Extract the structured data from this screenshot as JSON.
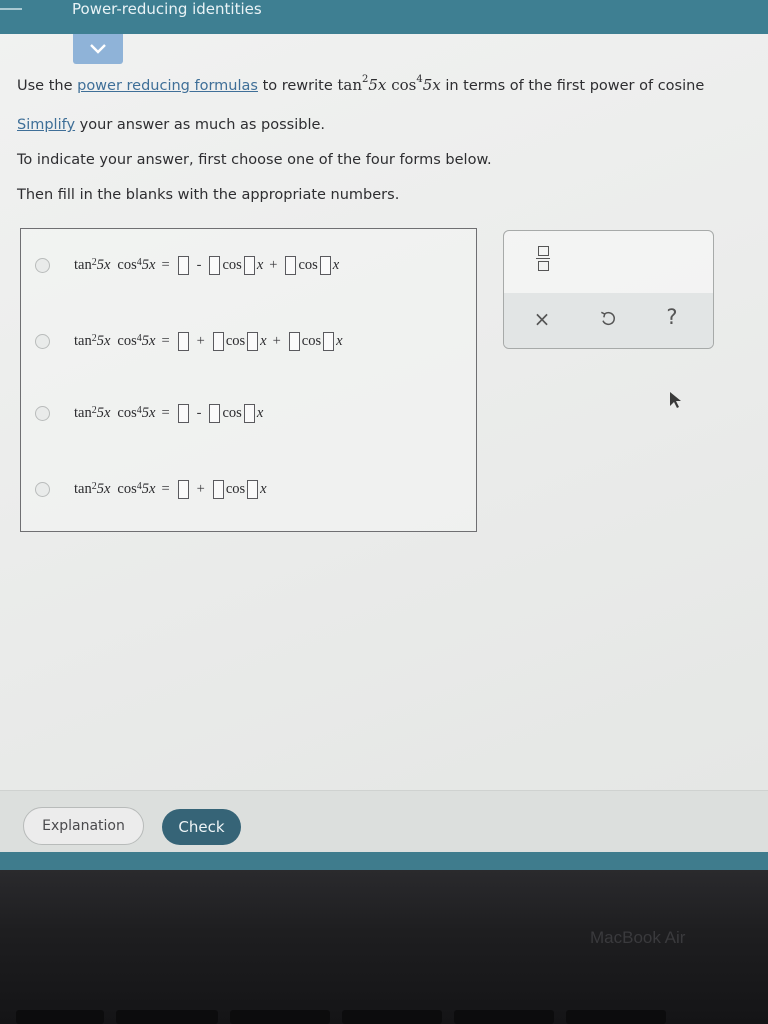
{
  "header": {
    "title": "Power-reducing identities"
  },
  "question": {
    "intro": "Use the",
    "link_formulas": "power reducing formulas",
    "after_link": "to rewrite",
    "expr_tan": "tan",
    "expr_tan_exp": "2",
    "expr_tan_arg": "5x",
    "expr_cos": "cos",
    "expr_cos_exp": "4",
    "expr_cos_arg": "5x",
    "tail": "in terms of the first power of cosine",
    "simplify_link": "Simplify",
    "simplify_rest": "your answer as much as possible.",
    "instruction": "To indicate your answer, first choose one of the four forms below.",
    "instruction2": "Then fill in the blanks with the appropriate numbers."
  },
  "forms": [
    {
      "lhs": "tan²5x cos⁴5x",
      "rhs_ops": [
        "−",
        "+"
      ],
      "terms": 3
    },
    {
      "lhs": "tan²5x cos⁴5x",
      "rhs_ops": [
        "+",
        "+"
      ],
      "terms": 3
    },
    {
      "lhs": "tan²5x cos⁴5x",
      "rhs_ops": [
        "−"
      ],
      "terms": 2
    },
    {
      "lhs": "tan²5x cos⁴5x",
      "rhs_ops": [
        "+"
      ],
      "terms": 2
    }
  ],
  "math": {
    "tan": "tan",
    "cos": "cos",
    "two": "2",
    "four": "4",
    "five_x": "5x",
    "eq": "=",
    "minus": "-",
    "plus": "+",
    "x": "x"
  },
  "tools": {
    "clear": "×",
    "help": "?"
  },
  "footer": {
    "explanation": "Explanation",
    "check": "Check"
  },
  "bezel": {
    "brand": "MacBook Air"
  }
}
